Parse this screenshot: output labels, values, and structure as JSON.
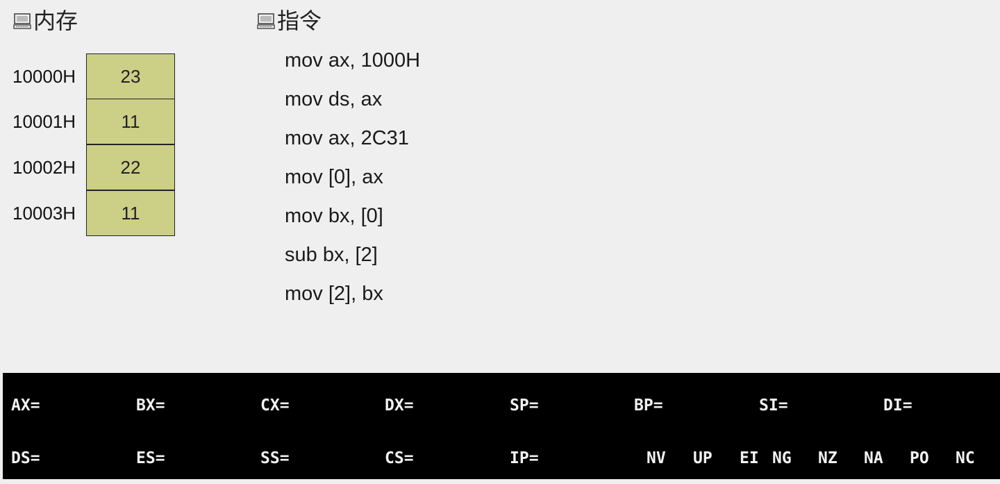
{
  "memory": {
    "title": "内存",
    "icon": "computer-icon",
    "rows": [
      {
        "address": "10000H",
        "value": "23"
      },
      {
        "address": "10001H",
        "value": "11"
      },
      {
        "address": "10002H",
        "value": "22"
      },
      {
        "address": "10003H",
        "value": "11"
      }
    ],
    "cell_color": "#cccf86"
  },
  "instructions": {
    "title": "指令",
    "icon": "computer-icon",
    "lines": [
      "mov ax, 1000H",
      "mov ds, ax",
      "mov ax, 2C31",
      "mov [0], ax",
      "mov bx, [0]",
      "sub bx, [2]",
      "mov [2], bx"
    ]
  },
  "registers": {
    "row1": [
      "AX=",
      "BX=",
      "CX=",
      "DX=",
      "SP=",
      "BP=",
      "SI=",
      "DI="
    ],
    "row2": [
      "DS=",
      "ES=",
      "SS=",
      "CS=",
      "IP="
    ],
    "flags": [
      "NV",
      "UP",
      "EI",
      "NG",
      "NZ",
      "NA",
      "PO",
      "NC"
    ]
  }
}
